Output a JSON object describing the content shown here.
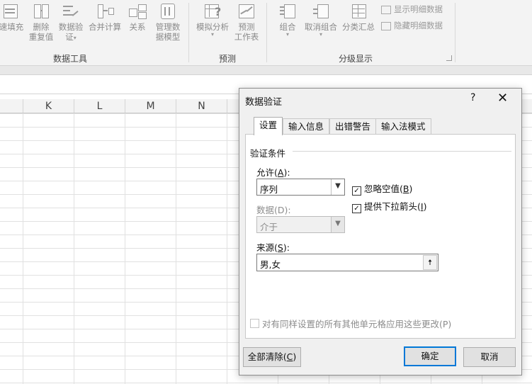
{
  "ribbon": {
    "data_tools": {
      "flash_fill": "速填充",
      "remove_duplicates": [
        "删除",
        "重复值"
      ],
      "data_validation": [
        "数据验",
        "证"
      ],
      "consolidate": "合并计算",
      "relationships": "关系",
      "manage_data_model": [
        "管理数",
        "据模型"
      ],
      "group_label": "数据工具"
    },
    "forecast": {
      "what_if": "模拟分析",
      "forecast_sheet": [
        "预测",
        "工作表"
      ],
      "group_label": "预测"
    },
    "outline": {
      "group": "组合",
      "ungroup": "取消组合",
      "subtotal": "分类汇总",
      "show_detail": "显示明细数据",
      "hide_detail": "隐藏明细数据",
      "group_label": "分级显示"
    }
  },
  "sheet": {
    "columns": [
      "K",
      "L",
      "M",
      "N"
    ]
  },
  "dialog": {
    "title": "数据验证",
    "help": "?",
    "close": "✕",
    "tabs": [
      "设置",
      "输入信息",
      "出错警告",
      "输入法模式"
    ],
    "active_tab": "设置",
    "criteria_label": "验证条件",
    "allow": {
      "label_text": "允许(",
      "label_key": "A",
      "label_end": "):",
      "value": "序列"
    },
    "data": {
      "label": "数据(D):",
      "value": "介于",
      "disabled": true
    },
    "ignore_blank": {
      "label_text": "忽略空值(",
      "label_key": "B",
      "label_end": ")",
      "checked": true
    },
    "in_cell_dropdown": {
      "label_text": "提供下拉箭头(",
      "label_key": "I",
      "label_end": ")",
      "checked": true
    },
    "source": {
      "label_text": "来源(",
      "label_key": "S",
      "label_end": "):",
      "value": "男,女"
    },
    "apply_all": {
      "label": "对有同样设置的所有其他单元格应用这些更改(P)",
      "checked": false,
      "disabled": true
    },
    "clear_all": {
      "label_text": "全部清除(",
      "label_key": "C",
      "label_end": ")"
    },
    "ok": "确定",
    "cancel": "取消"
  },
  "colors": {
    "accent": "#0078d7",
    "ribbon_bg": "#f3f3f3",
    "dialog_bg": "#f0f0f0"
  }
}
